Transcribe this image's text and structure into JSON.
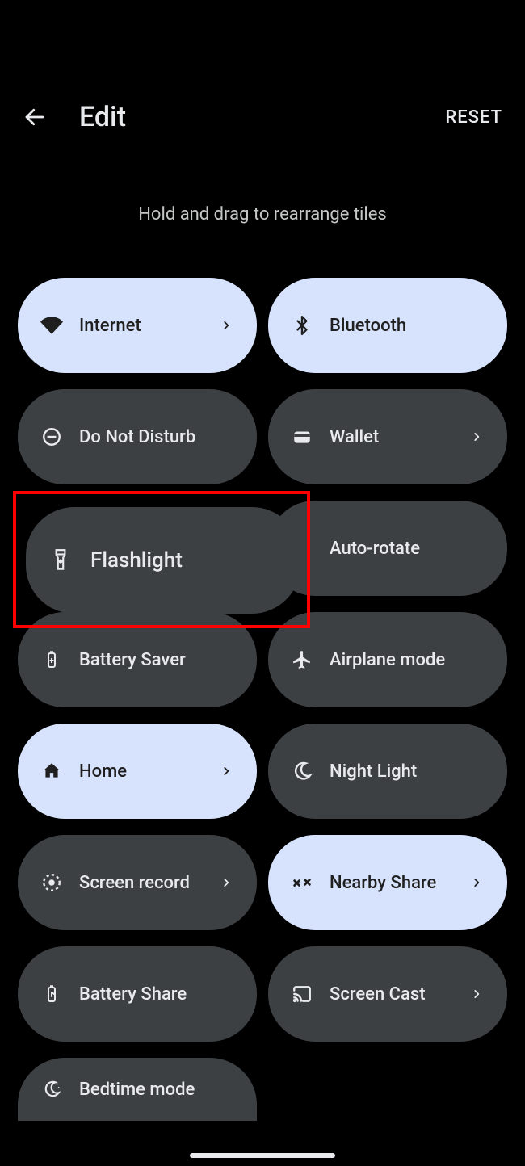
{
  "header": {
    "title": "Edit",
    "reset": "RESET"
  },
  "hint": "Hold and drag to rearrange tiles",
  "tiles": {
    "internet": {
      "label": "Internet",
      "icon": "wifi-icon"
    },
    "bluetooth": {
      "label": "Bluetooth",
      "icon": "bluetooth-icon"
    },
    "dnd": {
      "label": "Do Not Disturb",
      "icon": "dnd-icon"
    },
    "wallet": {
      "label": "Wallet",
      "icon": "wallet-icon"
    },
    "flashlight": {
      "label": "Flashlight",
      "icon": "flashlight-icon"
    },
    "autorotate": {
      "label": "Auto-rotate",
      "icon": "autorotate-icon"
    },
    "battery_saver": {
      "label": "Battery Saver",
      "icon": "battery-saver-icon"
    },
    "airplane": {
      "label": "Airplane mode",
      "icon": "airplane-icon"
    },
    "home": {
      "label": "Home",
      "icon": "home-icon"
    },
    "night_light": {
      "label": "Night Light",
      "icon": "night-light-icon"
    },
    "screen_record": {
      "label": "Screen record",
      "icon": "screen-record-icon"
    },
    "nearby_share": {
      "label": "Nearby Share",
      "icon": "nearby-share-icon"
    },
    "battery_share": {
      "label": "Battery Share",
      "icon": "battery-share-icon"
    },
    "screen_cast": {
      "label": "Screen Cast",
      "icon": "cast-icon"
    },
    "bedtime": {
      "label": "Bedtime mode",
      "icon": "bedtime-icon"
    }
  }
}
